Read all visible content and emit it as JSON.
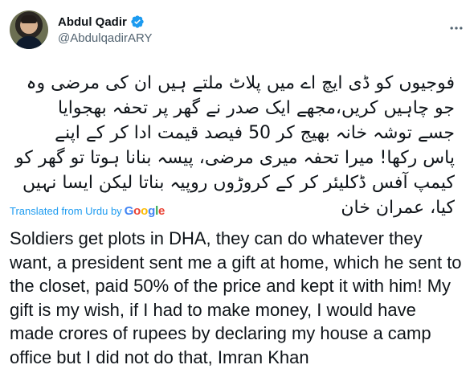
{
  "user": {
    "display_name": "Abdul Qadir",
    "handle": "@AbdulqadirARY"
  },
  "tweet": {
    "original_text": "فوجیوں کو ڈی ایچ اے میں پلاٹ ملتے ہیں ان کی مرضی وہ\nجو چاہیں کریں،مجھے ایک صدر نے گھر پر تحفہ بھجوایا\nجسے توشہ خانہ بھیج کر 50 فیصد قیمت ادا کر کے اپنے\nپاس رکھا! میرا تحفہ میری مرضی، پیسہ بنانا ہوتا تو گھر کو\nکیمپ آفس ڈکلیئر کر کے کروڑوں روپیہ بناتا لیکن ایسا نہیں\nکیا، عمران خان",
    "translated_label": "Translated from Urdu by",
    "translator_brand": "Google",
    "translated_text": "Soldiers get plots in DHA, they can do whatever they want, a president sent me a gift at home, which he sent to the closet, paid 50% of the price and kept it with him! My gift is my wish, if I had to make money, I would have made crores of rupees by declaring my house a camp office but I did not do that, Imran Khan"
  },
  "icons": {
    "verified": "verified-badge-icon",
    "more": "more-options-icon"
  },
  "colors": {
    "accent": "#1d9bf0",
    "text": "#0f1419",
    "secondary": "#536471"
  }
}
